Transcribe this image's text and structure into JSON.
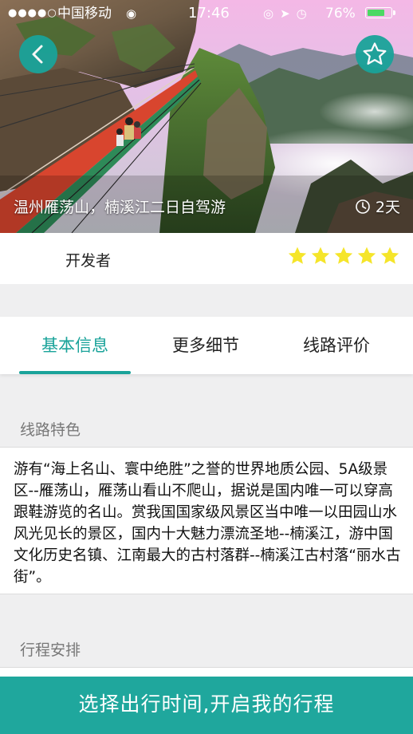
{
  "status_bar": {
    "signal_dots": "●●●●○",
    "carrier": "中国移动",
    "time": "17:46",
    "battery_percent": "76%",
    "battery_level": 0.76
  },
  "hero": {
    "title": "温州雁荡山，楠溪江二日自驾游",
    "duration": "2天",
    "back_icon": "chevron-left-icon",
    "favorite_icon": "star-outline-icon"
  },
  "developer": {
    "label": "开发者",
    "rating": 5,
    "rating_max": 5
  },
  "tabs": [
    {
      "label": "基本信息",
      "active": true
    },
    {
      "label": "更多细节",
      "active": false
    },
    {
      "label": "线路评价",
      "active": false
    }
  ],
  "sections": {
    "features_title": "线路特色",
    "features_text": "游有“海上名山、寰中绝胜”之誉的世界地质公园、5A级景区--雁荡山，雁荡山看山不爬山，据说是国内唯一可以穿高跟鞋游览的名山。赏我国国家级风景区当中唯一以田园山水风光见长的景区，国内十大魅力漂流圣地--楠溪江，游中国文化历史名镇、江南最大的古村落群--楠溪江古村落“丽水古街”。",
    "schedule_title": "行程安排"
  },
  "cta": {
    "label": "选择出行时间,开启我的行程"
  },
  "colors": {
    "accent": "#1aa39a",
    "star": "#f5e52a",
    "background": "#efeff0"
  }
}
